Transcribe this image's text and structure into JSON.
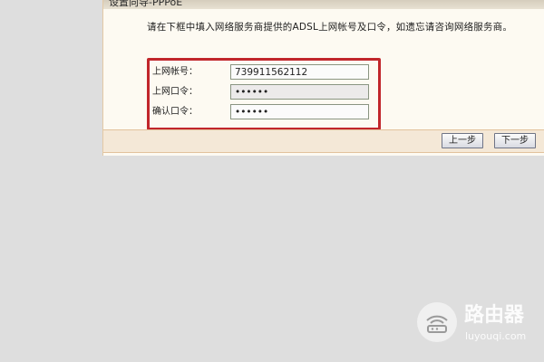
{
  "dialog": {
    "title": "设置向导-PPPoE",
    "instruction": "请在下框中填入网络服务商提供的ADSL上网帐号及口令，如遗忘请咨询网络服务商。"
  },
  "form": {
    "account": {
      "label": "上网帐号：",
      "value": "739911562112"
    },
    "password": {
      "label": "上网口令：",
      "value": "••••••"
    },
    "confirm": {
      "label": "确认口令：",
      "value": "••••••"
    }
  },
  "buttons": {
    "prev": "上一步",
    "next": "下一步"
  },
  "colors": {
    "highlight": "#c1262b",
    "panel_background": "#fdfaf2",
    "button_bar": "#f4e8d7"
  },
  "watermark": {
    "title": "路由器",
    "url": "luyouqi.com",
    "icon": "router-wifi-icon"
  }
}
